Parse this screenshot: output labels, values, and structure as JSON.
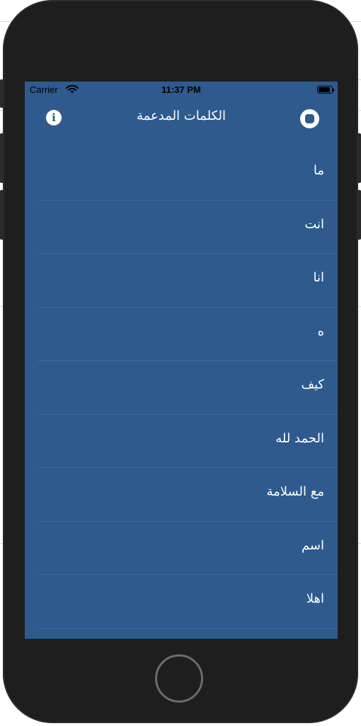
{
  "status_bar": {
    "carrier": "Carrier",
    "time": "11:37 PM",
    "wifi_icon": "wifi-icon",
    "battery_icon": "battery-icon"
  },
  "nav": {
    "title": "الكلمات المدعمة",
    "info_icon": "info-icon",
    "info_glyph": "i",
    "stop_icon": "stop-icon"
  },
  "words": [
    "ما",
    "انت",
    "انا",
    "ه",
    "كيف",
    "الحمد لله",
    "مع السلامة",
    "اسم",
    "اهلا"
  ],
  "colors": {
    "screen_background": "#2e5a8e",
    "separator": "#3d6a9c",
    "text": "#ffffff",
    "device_body": "#1e1e1e"
  }
}
